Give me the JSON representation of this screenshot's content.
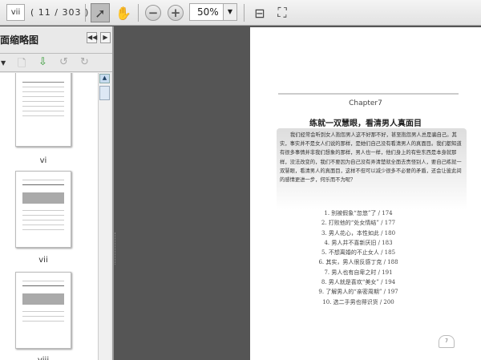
{
  "toolbar": {
    "page_input": "vii",
    "page_count": "( 11 / 303 )",
    "zoom": "50%"
  },
  "panel": {
    "title": "面缩略图",
    "thumbnails": [
      {
        "label": "vi"
      },
      {
        "label": "vii"
      },
      {
        "label": "viii"
      }
    ]
  },
  "page": {
    "chapter": "Chapter7",
    "title": "练就一双慧眼，看清男人真面目",
    "intro": "我们经常会听到女人抱怨男人这不好那不好，甚至抱怨男人总是骗自己。其实，事实并不是女人们说的那样，是她们自己没有看清男人的真面目。我们都知道有很多事情并非我们想象的那样，男人也一样，他们身上的有些东西是本身就那样，没法改变的，我们不要因为自己没有弄清楚就全面去责怪别人，要自己练就一双慧眼，看清男人的真面目，这样不但可以减少很多不必要的矛盾，还会让彼此间的感情更进一步，何乐而不为呢？",
    "toc": [
      "1. 别被假象“忽悠”了 / 174",
      "2. 打败他的“处女情结” / 177",
      "3. 男人花心，本性如此 / 180",
      "4. 男人并不喜新厌旧 / 183",
      "5. 不想离婚的不止女人 / 185",
      "6. 其实，男人很反感丁克 / 188",
      "7. 男人也有自卑之时 / 191",
      "8. 男人就是喜欢“美女” / 194",
      "9. 了解男人的“亲密周期” / 197",
      "10. 选二手男也得识货 / 200"
    ],
    "folio": "7"
  }
}
